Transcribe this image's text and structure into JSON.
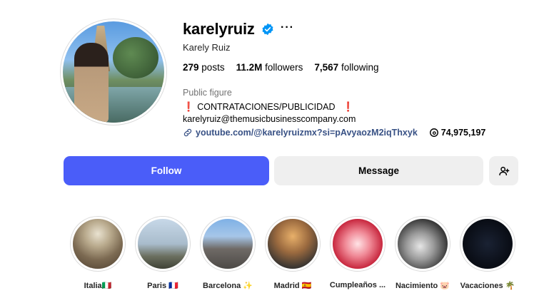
{
  "profile": {
    "username": "karelyruiz",
    "full_name": "Karely Ruiz",
    "more_label": "···",
    "stats": {
      "posts_count": "279",
      "posts_label": "posts",
      "followers_count": "11.2M",
      "followers_label": "followers",
      "following_count": "7,567",
      "following_label": "following"
    },
    "category": "Public figure",
    "bio_line": "CONTRATACIONES/PUBLICIDAD",
    "bio_mark": "❗",
    "email": "karelyruiz@themusicbusinesscompany.com",
    "link": "youtube.com/@karelyruizmx?si=pAvyaozM2iqThxyk",
    "threads_count": "74,975,197"
  },
  "actions": {
    "follow_label": "Follow",
    "message_label": "Message"
  },
  "highlights": [
    {
      "label": "Italia🇮🇹"
    },
    {
      "label": "Paris 🇫🇷"
    },
    {
      "label": "Barcelona ✨"
    },
    {
      "label": "Madrid 🇪🇸"
    },
    {
      "label": "Cumpleaños ..."
    },
    {
      "label": "Nacimiento 🐷"
    },
    {
      "label": "Vacaciones 🌴"
    }
  ],
  "colors": {
    "follow_button": "#4a5df9",
    "secondary_button": "#efefef",
    "verified_badge": "#0095f6",
    "link": "#385185"
  },
  "icons": {
    "verified": "verified-badge-icon",
    "more": "more-options-icon",
    "link": "link-icon",
    "threads": "threads-icon",
    "add_user": "add-user-icon"
  }
}
